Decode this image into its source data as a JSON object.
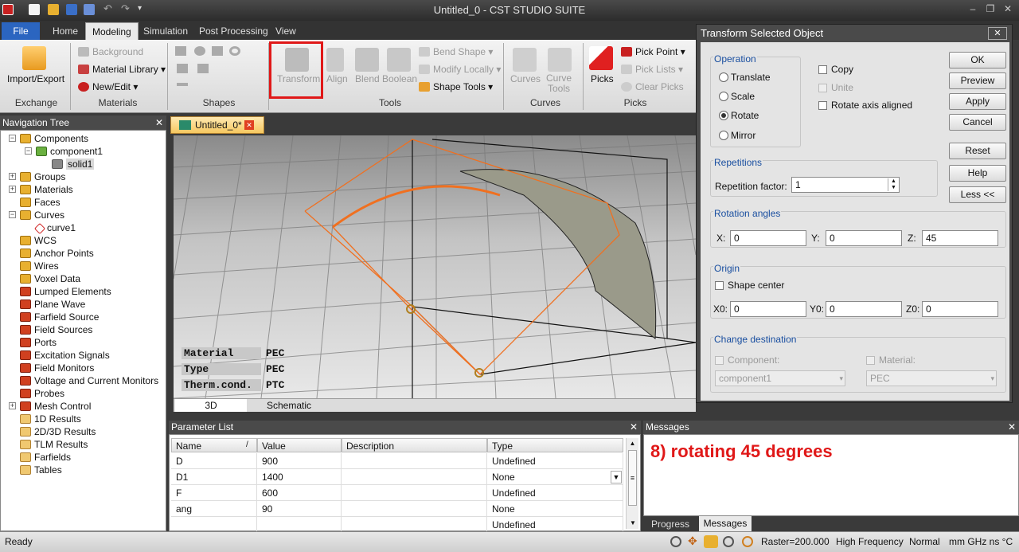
{
  "window": {
    "title": "Untitled_0 - CST STUDIO SUITE"
  },
  "menu_tabs": [
    "File",
    "Home",
    "Modeling",
    "Simulation",
    "Post Processing",
    "View"
  ],
  "ribbon": {
    "exchange": {
      "import_export": "Import/Export",
      "group": "Exchange"
    },
    "materials": {
      "background": "Background",
      "material_library": "Material Library",
      "new_edit": "New/Edit",
      "group": "Materials"
    },
    "shapes": {
      "group": "Shapes"
    },
    "tools": {
      "transform": "Transform",
      "align": "Align",
      "blend": "Blend",
      "boolean": "Boolean",
      "bend_shape": "Bend Shape",
      "modify_locally": "Modify Locally",
      "shape_tools": "Shape Tools",
      "group": "Tools"
    },
    "curves": {
      "curves": "Curves",
      "curve_tools": "Curve Tools",
      "group": "Curves"
    },
    "picks": {
      "picks": "Picks",
      "pick_point": "Pick Point",
      "pick_lists": "Pick Lists",
      "clear_picks": "Clear Picks",
      "group": "Picks"
    }
  },
  "nav_tree": {
    "title": "Navigation Tree",
    "items": [
      "Components",
      "component1",
      "solid1",
      "Groups",
      "Materials",
      "Faces",
      "Curves",
      "curve1",
      "WCS",
      "Anchor Points",
      "Wires",
      "Voxel Data",
      "Lumped Elements",
      "Plane Wave",
      "Farfield Source",
      "Field Sources",
      "Ports",
      "Excitation Signals",
      "Field Monitors",
      "Voltage and Current Monitors",
      "Probes",
      "Mesh Control",
      "1D Results",
      "2D/3D Results",
      "TLM Results",
      "Farfields",
      "Tables"
    ]
  },
  "document": {
    "tab": "Untitled_0*",
    "view_tabs": [
      "3D",
      "Schematic"
    ]
  },
  "viewport_info": [
    {
      "key": "Material",
      "value": "PEC"
    },
    {
      "key": "Type",
      "value": "PEC"
    },
    {
      "key": "Therm.cond.",
      "value": "PTC"
    }
  ],
  "parameter_list": {
    "title": "Parameter List",
    "columns": [
      "Name",
      "Value",
      "Description",
      "Type"
    ],
    "rows": [
      {
        "name": "D",
        "value": "900",
        "desc": "",
        "type": "Undefined"
      },
      {
        "name": "D1",
        "value": "1400",
        "desc": "",
        "type": "None"
      },
      {
        "name": "F",
        "value": "600",
        "desc": "",
        "type": "Undefined"
      },
      {
        "name": "ang",
        "value": "90",
        "desc": "",
        "type": "None"
      },
      {
        "name": "",
        "value": "",
        "desc": "",
        "type": "Undefined"
      }
    ]
  },
  "messages": {
    "title": "Messages",
    "text": "8) rotating 45 degrees",
    "tabs": [
      "Progress",
      "Messages"
    ]
  },
  "status_bar": {
    "left": "Ready",
    "raster": "Raster=200.000",
    "solver": "High Frequency",
    "mode": "Normal",
    "units": "mm GHz ns °C"
  },
  "dialog": {
    "title": "Transform Selected Object",
    "operation_label": "Operation",
    "operations": [
      "Translate",
      "Scale",
      "Rotate",
      "Mirror"
    ],
    "selected_operation": "Rotate",
    "copy": "Copy",
    "unite": "Unite",
    "rotate_axis_aligned": "Rotate axis aligned",
    "buttons": [
      "OK",
      "Preview",
      "Apply",
      "Cancel",
      "Reset",
      "Help",
      "Less <<"
    ],
    "repetitions_label": "Repetitions",
    "repetition_factor_label": "Repetition factor:",
    "repetition_factor": "1",
    "rotation_label": "Rotation angles",
    "x_label": "X:",
    "x": "0",
    "y_label": "Y:",
    "y": "0",
    "z_label": "Z:",
    "z": "45",
    "origin_label": "Origin",
    "shape_center": "Shape center",
    "x0_label": "X0:",
    "x0": "0",
    "y0_label": "Y0:",
    "y0": "0",
    "z0_label": "Z0:",
    "z0": "0",
    "change_dest_label": "Change destination",
    "component_label": "Component:",
    "component": "component1",
    "material_label": "Material:",
    "material": "PEC"
  },
  "colors": {
    "annotation_red": "#e01818",
    "file_tab": "#2b65c0",
    "group_label": "#1a4fa0"
  }
}
